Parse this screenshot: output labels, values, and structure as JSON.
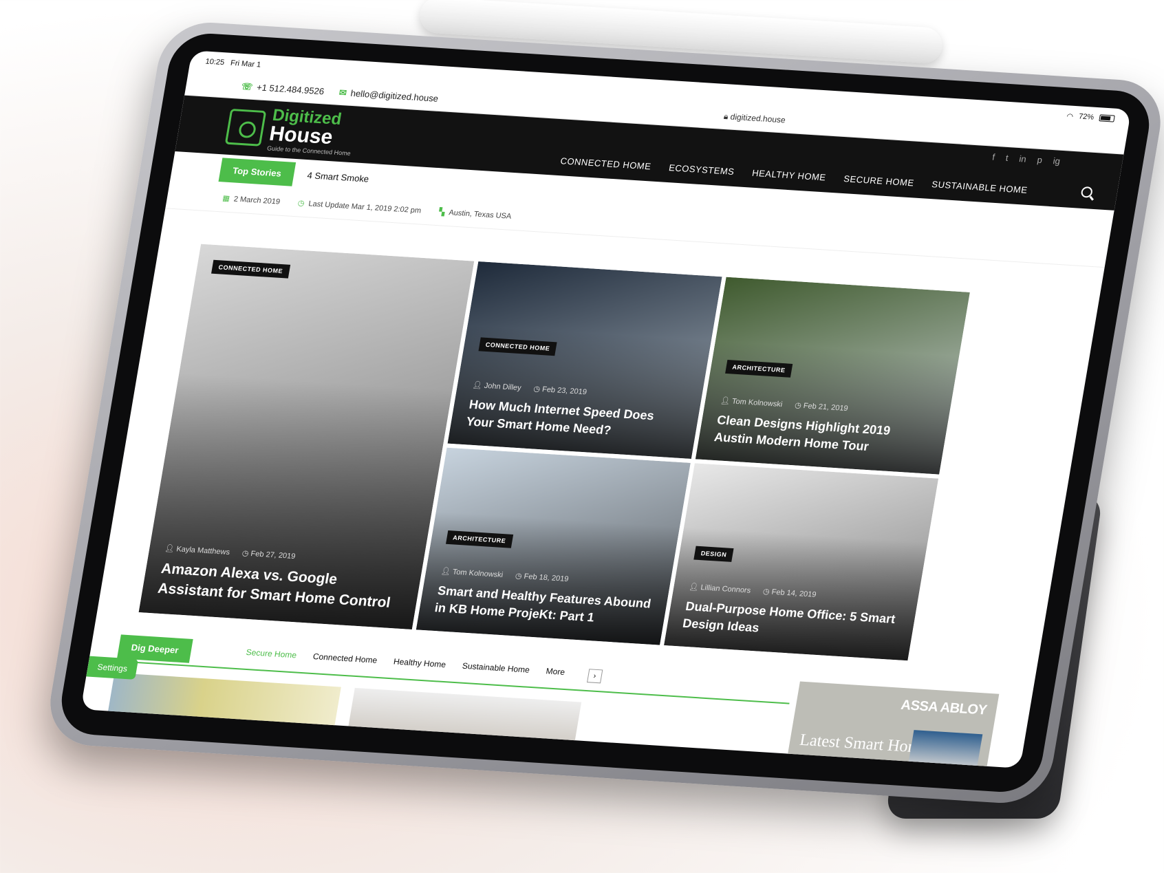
{
  "status": {
    "time": "10:25",
    "day": "Fri Mar 1",
    "battery": "72%"
  },
  "topbar": {
    "phone": "+1 512.484.9526",
    "email": "hello@digitized.house",
    "url": "digitized.house"
  },
  "logo": {
    "line1": "Digitized",
    "line2": "House",
    "tagline": "Guide to the Connected Home"
  },
  "nav": [
    "CONNECTED HOME",
    "ECOSYSTEMS",
    "HEALTHY HOME",
    "SECURE HOME",
    "SUSTAINABLE HOME"
  ],
  "social": [
    "f",
    "t",
    "in",
    "p",
    "ig"
  ],
  "ticker": {
    "label": "Top Stories",
    "text": "4 Smart Smoke"
  },
  "meta": {
    "date": "2 March 2019",
    "updated": "Last Update Mar 1, 2019 2:02 pm",
    "location": "Austin, Texas USA"
  },
  "cards": [
    {
      "category": "CONNECTED HOME",
      "author": "Kayla Matthews",
      "date": "Feb 27, 2019",
      "title": "Amazon Alexa vs. Google Assistant for Smart Home Control",
      "colors": [
        "#d8d8d8",
        "#6d6d6d"
      ]
    },
    {
      "category": "CONNECTED HOME",
      "author": "John Dilley",
      "date": "Feb 23, 2019",
      "title": "How Much Internet Speed Does Your Smart Home Need?",
      "colors": [
        "#1e2a3a",
        "#a8b3bd"
      ]
    },
    {
      "category": "ARCHITECTURE",
      "author": "Tom Kolnowski",
      "date": "Feb 21, 2019",
      "title": "Clean Designs Highlight 2019 Austin Modern Home Tour",
      "colors": [
        "#3f5a2e",
        "#cfd6d8"
      ]
    },
    {
      "category": "ARCHITECTURE",
      "author": "Tom Kolnowski",
      "date": "Feb 18, 2019",
      "title": "Smart and Healthy Features Abound in KB Home ProjeKt: Part 1",
      "colors": [
        "#c7d3de",
        "#555a5f"
      ]
    },
    {
      "category": "DESIGN",
      "author": "Lillian Connors",
      "date": "Feb 14, 2019",
      "title": "Dual-Purpose Home Office: 5 Smart Design Ideas",
      "colors": [
        "#e8e8e8",
        "#7a7a7a"
      ]
    }
  ],
  "dig": {
    "label": "Dig Deeper",
    "tabs": [
      "Secure Home",
      "Connected Home",
      "Healthy Home",
      "Sustainable Home",
      "More"
    ]
  },
  "settings": "Settings",
  "ad": {
    "brand": "ASSA ABLOY",
    "headline": "Latest Smart Home"
  },
  "accent": "#4dbd4a"
}
